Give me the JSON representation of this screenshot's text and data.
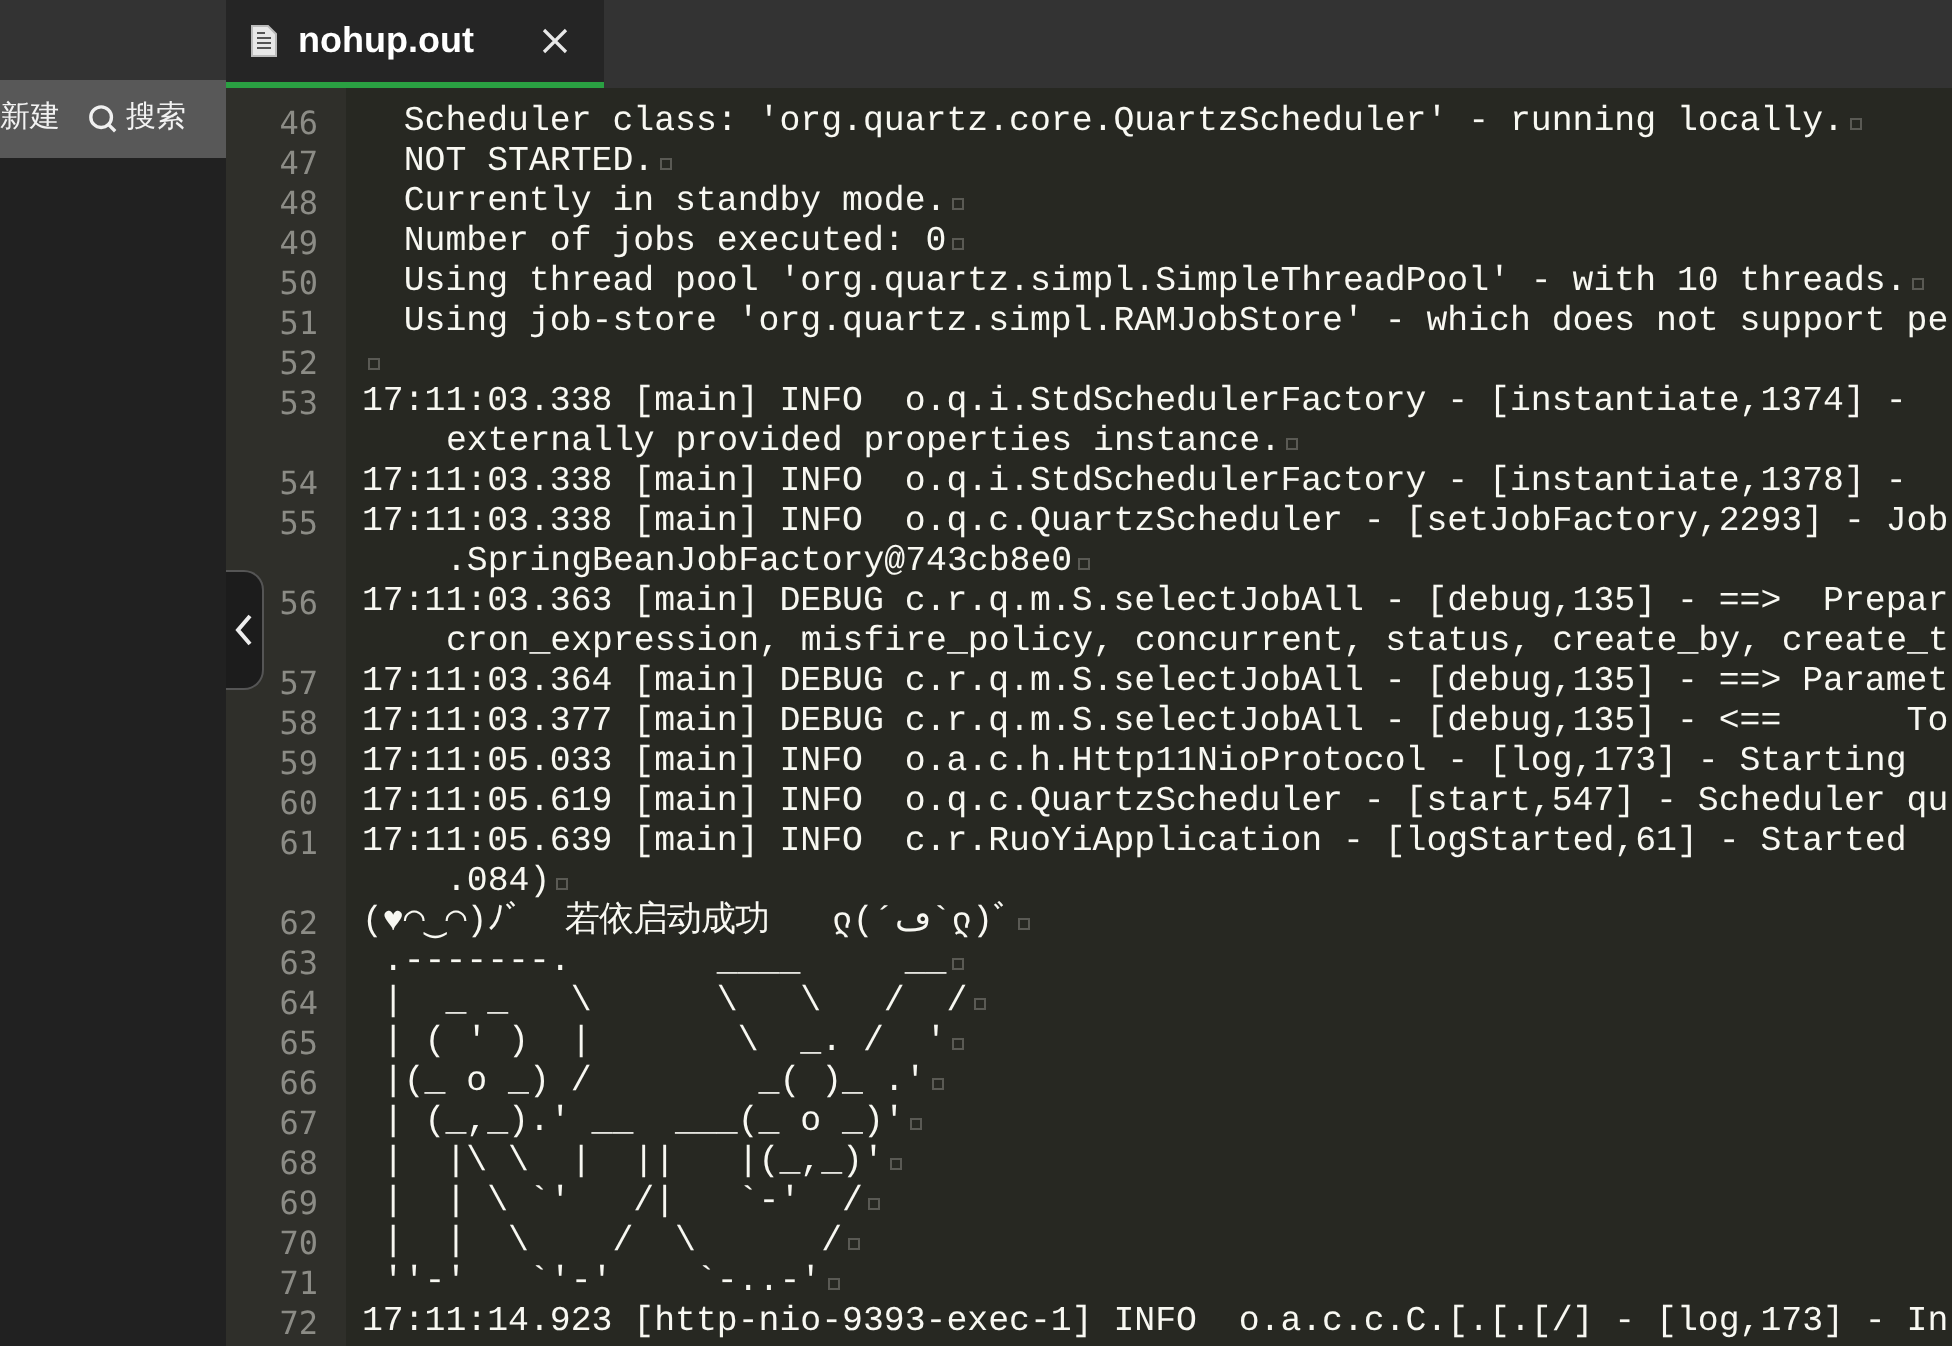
{
  "sidebar": {
    "toolbar": [
      {
        "kind": "text",
        "label": "新建"
      },
      {
        "kind": "search",
        "label": "搜索"
      }
    ]
  },
  "tabs": [
    {
      "label": "nohup.out",
      "selected": true
    }
  ],
  "editor": {
    "lines": [
      {
        "number": "46",
        "rows": [
          "  Scheduler class: 'org.quartz.core.QuartzScheduler' - running locally."
        ],
        "eol": true
      },
      {
        "number": "47",
        "rows": [
          "  NOT STARTED."
        ],
        "eol": true
      },
      {
        "number": "48",
        "rows": [
          "  Currently in standby mode."
        ],
        "eol": true
      },
      {
        "number": "49",
        "rows": [
          "  Number of jobs executed: 0"
        ],
        "eol": true
      },
      {
        "number": "50",
        "rows": [
          "  Using thread pool 'org.quartz.simpl.SimpleThreadPool' - with 10 threads."
        ],
        "eol": true
      },
      {
        "number": "51",
        "rows": [
          "  Using job-store 'org.quartz.simpl.RAMJobStore' - which does not support pe"
        ],
        "eol": false
      },
      {
        "number": "52",
        "eol": true
      },
      {
        "number": "53",
        "rows": [
          "17:11:03.338 [main] INFO  o.q.i.StdSchedulerFactory - [instantiate,1374] -",
          "externally provided properties instance."
        ],
        "eol": true
      },
      {
        "number": "54",
        "rows": [
          "17:11:03.338 [main] INFO  o.q.i.StdSchedulerFactory - [instantiate,1378] -"
        ],
        "eol": false
      },
      {
        "number": "55",
        "rows": [
          "17:11:03.338 [main] INFO  o.q.c.QuartzScheduler - [setJobFactory,2293] - Job",
          ".SpringBeanJobFactory@743cb8e0"
        ],
        "eol": true
      },
      {
        "number": "56",
        "rows": [
          "17:11:03.363 [main] DEBUG c.r.q.m.S.selectJobAll - [debug,135] - ==>  Prepar",
          "cron_expression, misfire_policy, concurrent, status, create_by, create_t"
        ],
        "eol": false
      },
      {
        "number": "57",
        "rows": [
          "17:11:03.364 [main] DEBUG c.r.q.m.S.selectJobAll - [debug,135] - ==> Paramet"
        ],
        "eol": false
      },
      {
        "number": "58",
        "rows": [
          "17:11:03.377 [main] DEBUG c.r.q.m.S.selectJobAll - [debug,135] - <==      To"
        ],
        "eol": false
      },
      {
        "number": "59",
        "rows": [
          "17:11:05.033 [main] INFO  o.a.c.h.Http11NioProtocol - [log,173] - Starting"
        ],
        "eol": false
      },
      {
        "number": "60",
        "rows": [
          "17:11:05.619 [main] INFO  o.q.c.QuartzScheduler - [start,547] - Scheduler qu"
        ],
        "eol": false
      },
      {
        "number": "61",
        "rows": [
          "17:11:05.639 [main] INFO  c.r.RuoYiApplication - [logStarted,61] - Started",
          ".084)"
        ],
        "eol": true
      },
      {
        "number": "62",
        "rows": [
          "(♥◠‿◠)ﾉﾞ  若依启动成功   ლ(´ڡ`ლ)ﾞ"
        ],
        "eol": true
      },
      {
        "number": "63",
        "rows": [
          " .-------.       ____     __"
        ],
        "eol": true
      },
      {
        "number": "64",
        "rows": [
          " |  _ _   \\      \\   \\   /  /"
        ],
        "eol": true
      },
      {
        "number": "65",
        "rows": [
          " | ( ' )  |       \\  _. /  '"
        ],
        "eol": true
      },
      {
        "number": "66",
        "rows": [
          " |(_ o _) /        _( )_ .'"
        ],
        "eol": true
      },
      {
        "number": "67",
        "rows": [
          " | (_,_).' __  ___(_ o _)'"
        ],
        "eol": true
      },
      {
        "number": "68",
        "rows": [
          " |  |\\ \\  |  ||   |(_,_)'"
        ],
        "eol": true
      },
      {
        "number": "69",
        "rows": [
          " |  | \\ `'   /|   `-'  /"
        ],
        "eol": true
      },
      {
        "number": "70",
        "rows": [
          " |  |  \\    /  \\      /"
        ],
        "eol": true
      },
      {
        "number": "71",
        "rows": [
          " ''-'   `'-'    `-..-'"
        ],
        "eol": true
      },
      {
        "number": "72",
        "rows": [
          "17:11:14.923 [http-nio-9393-exec-1] INFO  o.a.c.c.C.[.[.[/] - [log,173] - In"
        ],
        "eol": false
      }
    ]
  }
}
